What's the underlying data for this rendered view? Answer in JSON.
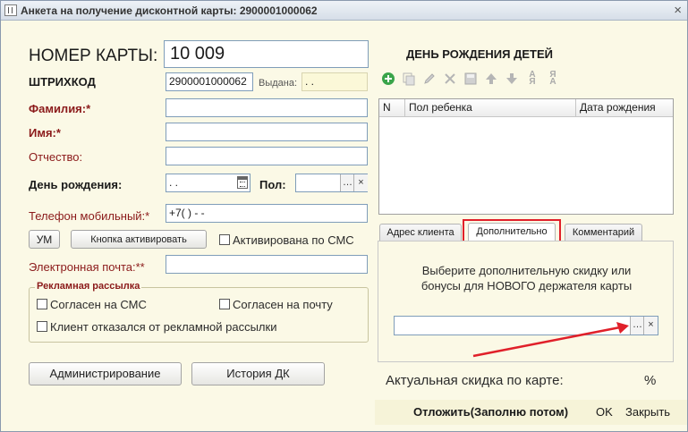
{
  "window": {
    "title": "Анкета на получение дисконтной карты: 2900001000062"
  },
  "left": {
    "card_number_label": "НОМЕР КАРТЫ:",
    "card_number_value": "10 009",
    "barcode_label": "ШТРИХКОД",
    "barcode_value": "2900001000062",
    "issued_label": "Выдана:",
    "issued_value": ". .",
    "surname_label": "Фамилия:*",
    "surname_value": "",
    "name_label": "Имя:*",
    "name_value": "",
    "patronymic_label": "Отчество:",
    "patronymic_value": "",
    "birthday_label": "День рождения:",
    "birthday_value": ". .",
    "gender_label": "Пол:",
    "gender_value": "",
    "phone_label": "Телефон мобильный:*",
    "phone_value": "+7(  )  -  -",
    "um_button": "УМ",
    "activate_button": "Кнопка активировать",
    "activated_sms_label": "Активирована по СМС",
    "email_label": "Электронная почта:**",
    "email_value": "",
    "ads_group_title": "Рекламная рассылка",
    "agree_sms_label": "Согласен на СМС",
    "agree_mail_label": "Согласен на почту",
    "refused_ads_label": "Клиент отказался от рекламной рассылки",
    "admin_button": "Администрирование",
    "history_button": "История ДК"
  },
  "right": {
    "children_title": "ДЕНЬ РОЖДЕНИЯ ДЕТЕЙ",
    "table": {
      "columns": [
        "N",
        "Пол ребенка",
        "Дата рождения"
      ],
      "rows": []
    },
    "tabs": [
      {
        "label": "Адрес клиента",
        "active": false
      },
      {
        "label": "Дополнительно",
        "active": true
      },
      {
        "label": "Комментарий",
        "active": false
      }
    ],
    "hint_line1": "Выберите дополнительную скидку или",
    "hint_line2": "бонусы для НОВОГО держателя карты",
    "discount_select_value": "",
    "actual_discount_label": "Актуальная скидка по карте:",
    "actual_discount_unit": "%"
  },
  "footer": {
    "postpone_button": "Отложить(Заполню потом)",
    "ok_button": "OK",
    "close_button": "Закрыть"
  },
  "icons": {
    "select": "…",
    "clear": "×",
    "calendar": "calendar-icon"
  },
  "colors": {
    "background": "#fbf9e6",
    "required_label": "#8b1a1a",
    "highlight": "#e0202a",
    "add_icon": "#3aa44a"
  }
}
